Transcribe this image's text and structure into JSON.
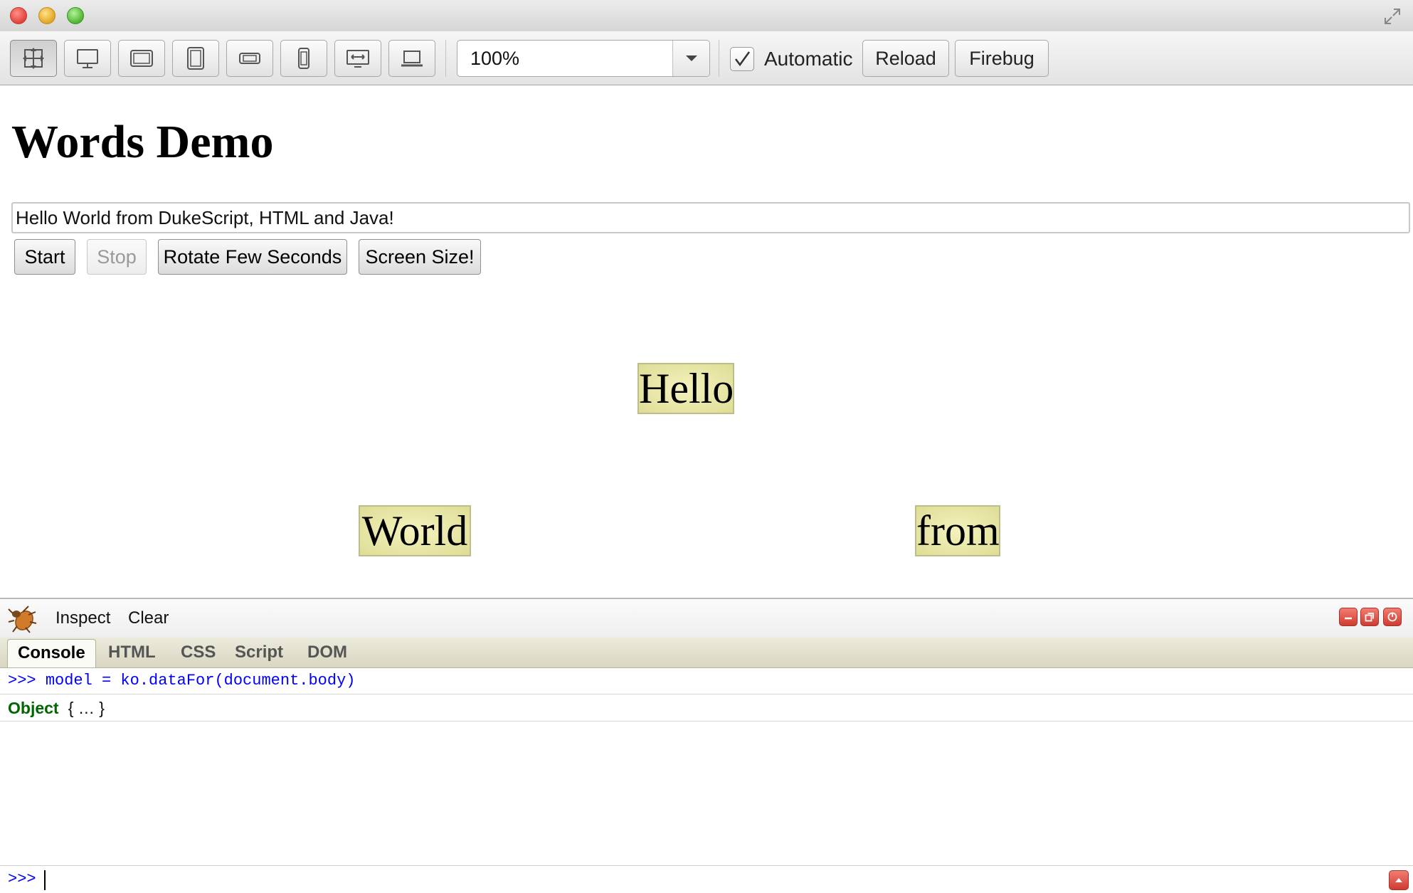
{
  "window": {
    "buttons": [
      "close",
      "minimize",
      "zoom"
    ]
  },
  "toolbar": {
    "device_buttons": [
      {
        "icon": "move-resize-icon",
        "active": true
      },
      {
        "icon": "desktop-icon"
      },
      {
        "icon": "tablet-landscape-icon"
      },
      {
        "icon": "tablet-portrait-icon"
      },
      {
        "icon": "phone-landscape-icon"
      },
      {
        "icon": "phone-portrait-icon"
      },
      {
        "icon": "tv-icon"
      },
      {
        "icon": "laptop-icon"
      }
    ],
    "zoom": "100%",
    "automatic_checked": true,
    "automatic_label": "Automatic",
    "reload_label": "Reload",
    "firebug_label": "Firebug"
  },
  "page": {
    "title": "Words Demo",
    "input_value": "Hello World from DukeScript, HTML and Java!",
    "buttons": {
      "start": "Start",
      "stop": "Stop",
      "rotate": "Rotate Few Seconds",
      "screen_size": "Screen Size!"
    },
    "words": [
      "Hello",
      "World",
      "from"
    ]
  },
  "firebug": {
    "inspect_label": "Inspect",
    "clear_label": "Clear",
    "tabs": [
      "Console",
      "HTML",
      "CSS",
      "Script",
      "DOM"
    ],
    "selected_tab": "Console",
    "console": {
      "command_prompt": ">>>",
      "command": "model = ko.dataFor(document.body)",
      "result_type": "Object",
      "result_value": "{ … }",
      "input_prompt": ">>>"
    },
    "colors": {
      "prompt": "#0000ff",
      "object": "#006600"
    }
  }
}
